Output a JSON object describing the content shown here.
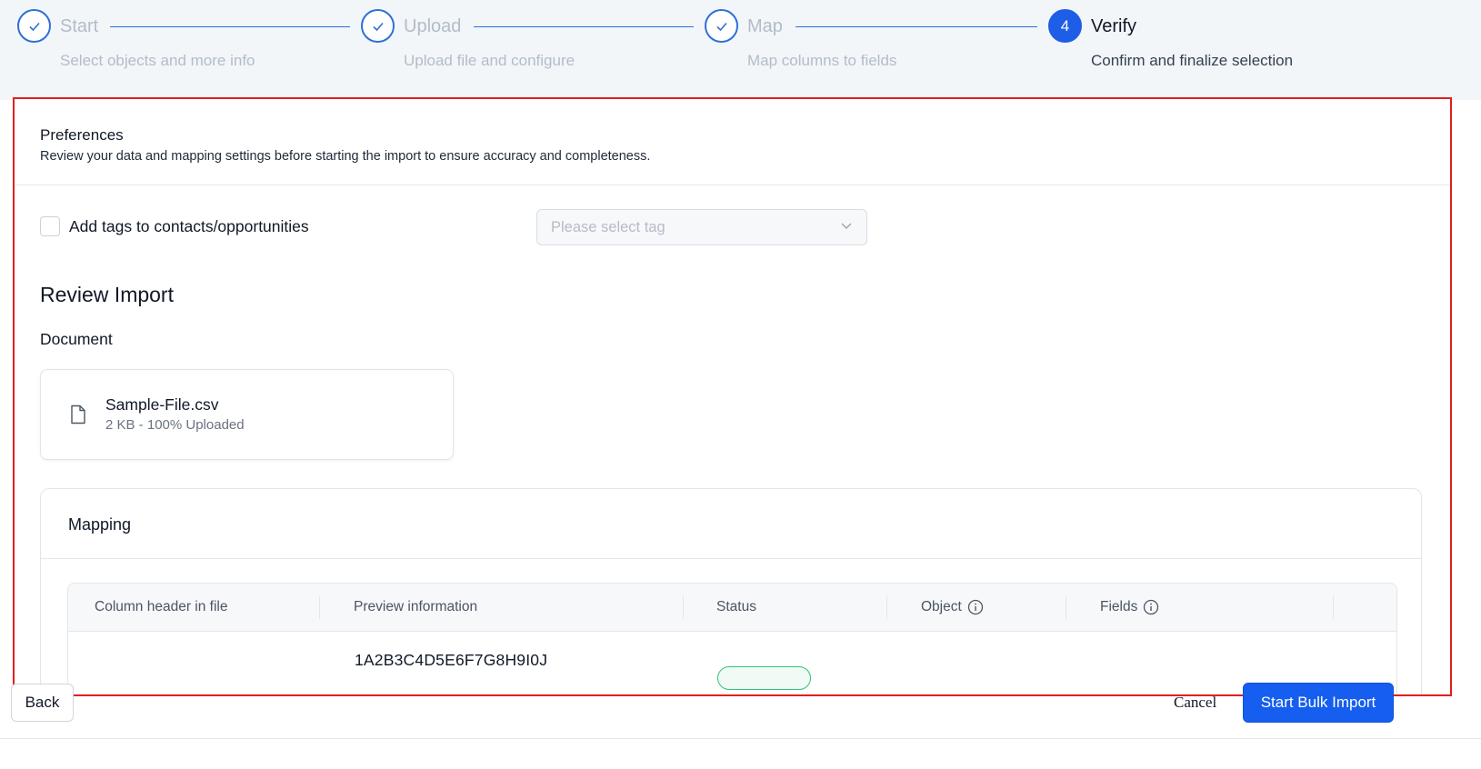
{
  "stepper": {
    "steps": [
      {
        "index": "1",
        "title": "Start",
        "subtitle": "Select objects and more info",
        "state": "completed"
      },
      {
        "index": "2",
        "title": "Upload",
        "subtitle": "Upload file and configure",
        "state": "completed"
      },
      {
        "index": "3",
        "title": "Map",
        "subtitle": "Map columns to fields",
        "state": "completed"
      },
      {
        "index": "4",
        "title": "Verify",
        "subtitle": "Confirm and finalize selection",
        "state": "active"
      }
    ]
  },
  "preferences": {
    "title": "Preferences",
    "description": "Review your data and mapping settings before starting the import to ensure accuracy and completeness.",
    "tags_checkbox_label": "Add tags to contacts/opportunities",
    "tags_checkbox_checked": false,
    "tag_select_placeholder": "Please select tag"
  },
  "review": {
    "title": "Review Import",
    "document_label": "Document",
    "file": {
      "name": "Sample-File.csv",
      "meta": "2 KB - 100% Uploaded",
      "upload_progress": 1.0
    }
  },
  "mapping": {
    "title": "Mapping",
    "columns": [
      "Column header in file",
      "Preview information",
      "Status",
      "Object",
      "Fields"
    ],
    "rows": [
      {
        "column_header": "",
        "preview": "1A2B3C4D5E6F7G8H9I0J",
        "status": "",
        "object": "",
        "fields": ""
      }
    ]
  },
  "footer": {
    "back_label": "Back",
    "cancel_label": "Cancel",
    "primary_label": "Start Bulk Import"
  },
  "colors": {
    "accent": "#155eef",
    "highlight_border": "#e0201c",
    "status_ok": "#34c27a"
  }
}
